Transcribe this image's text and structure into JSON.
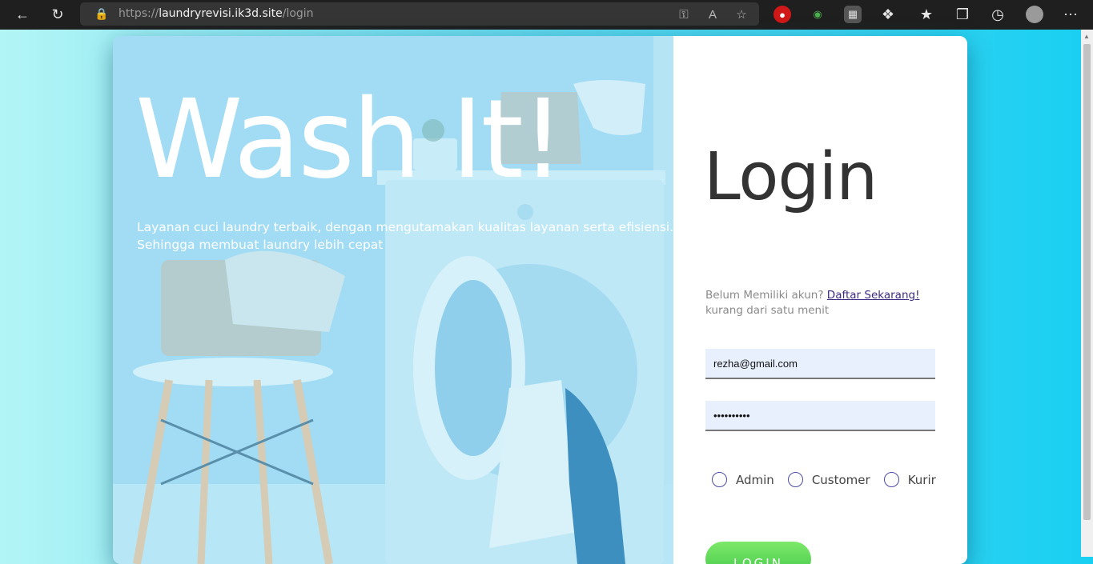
{
  "browser": {
    "url_prefix": "https://",
    "url_host": "laundryrevisi.ik3d.site",
    "url_path": "/login"
  },
  "hero": {
    "title": "Wash It!",
    "tagline_line1": "Layanan cuci laundry terbaik, dengan mengutamakan kualitas layanan serta efisiensi.",
    "tagline_line2": "Sehingga membuat laundry lebih cepat"
  },
  "login": {
    "title": "Login",
    "register_prompt": "Belum Memiliki akun?",
    "register_link": "Daftar Sekarang!",
    "register_note": "kurang dari satu menit",
    "email_value": "rezha@gmail.com",
    "password_value": "••••••••••",
    "roles": [
      {
        "label": "Admin"
      },
      {
        "label": "Customer"
      },
      {
        "label": "Kurir"
      }
    ],
    "button_label": "LOGIN"
  },
  "colors": {
    "accent_link": "#3c2b80",
    "button_green": "#45c94a",
    "hero_overlay": "#9fdcf3"
  }
}
